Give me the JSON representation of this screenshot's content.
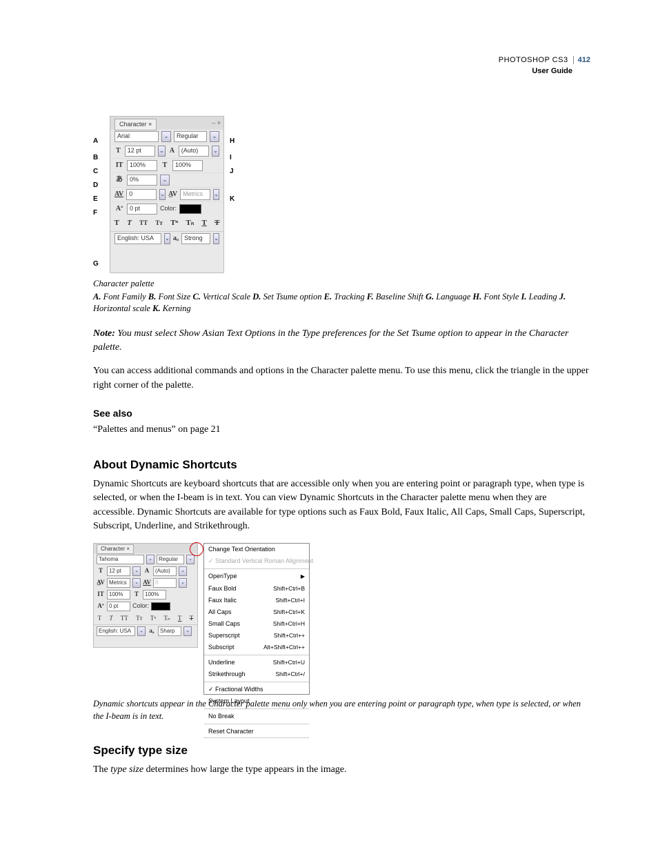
{
  "header": {
    "product": "PHOTOSHOP CS3",
    "pageno": "412",
    "subtitle": "User Guide"
  },
  "fig1": {
    "tab": "Character ×",
    "close": "– ×",
    "font_family": "Arial",
    "font_style": "Regular",
    "font_size": "12 pt",
    "leading": "(Auto)",
    "vscale": "100%",
    "hscale": "100%",
    "tsume": "0%",
    "tracking": "0",
    "kerning": "Metrics",
    "baseline": "0 pt",
    "color_label": "Color:",
    "language": "English: USA",
    "aa_label": "aₐ",
    "aa_value": "Strong",
    "callouts": {
      "A": "A",
      "B": "B",
      "C": "C",
      "D": "D",
      "E": "E",
      "F": "F",
      "G": "G",
      "H": "H",
      "I": "I",
      "J": "J",
      "K": "K"
    }
  },
  "fig1_caption": "Character palette",
  "fig1_legend_parts": [
    {
      "b": "A.",
      "t": " Font Family  "
    },
    {
      "b": "B.",
      "t": " Font Size  "
    },
    {
      "b": "C.",
      "t": " Vertical Scale  "
    },
    {
      "b": "D.",
      "t": " Set Tsume option  "
    },
    {
      "b": "E.",
      "t": " Tracking  "
    },
    {
      "b": "F.",
      "t": " Baseline Shift  "
    },
    {
      "b": "G.",
      "t": " Language  "
    },
    {
      "b": "H.",
      "t": " Font Style  "
    },
    {
      "b": "I.",
      "t": " Leading "
    },
    {
      "b": "J.",
      "t": " Horizontal scale  "
    },
    {
      "b": "K.",
      "t": " Kerning"
    }
  ],
  "note_label": "Note:",
  "note_text": " You must select Show Asian Text Options in the Type preferences for the Set Tsume option to appear in the Character palette.",
  "para_access": "You can access additional commands and options in the Character palette menu. To use this menu, click the triangle in the upper right corner of the palette.",
  "see_also_heading": "See also",
  "see_also_link": "“Palettes and menus” on page 21",
  "section_dynamic": "About Dynamic Shortcuts",
  "para_dynamic": "Dynamic Shortcuts are keyboard shortcuts that are accessible only when you are entering point or paragraph type, when type is selected, or when the I-beam is in text. You can view Dynamic Shortcuts in the Character palette menu when they are accessible. Dynamic Shortcuts are available for type options such as Faux Bold, Faux Italic, All Caps, Small Caps, Superscript, Subscript, Underline, and Strikethrough.",
  "fig2": {
    "tab": "Character ×",
    "font_family": "Tahoma",
    "font_style": "Regular",
    "font_size": "12 pt",
    "leading": "(Auto)",
    "kerning": "Metrics",
    "tracking": "0",
    "vscale": "100%",
    "hscale": "100%",
    "baseline": "0 pt",
    "color_label": "Color:",
    "language": "English: USA",
    "aa_value": "Sharp",
    "menu": {
      "change_orient": "Change Text Orientation",
      "svra": "Standard Vertical Roman Alignment",
      "opentype": "OpenType",
      "items": [
        {
          "label": "Faux Bold",
          "sc": "Shift+Ctrl+B"
        },
        {
          "label": "Faux Italic",
          "sc": "Shift+Ctrl+I"
        },
        {
          "label": "All Caps",
          "sc": "Shift+Ctrl+K"
        },
        {
          "label": "Small Caps",
          "sc": "Shift+Ctrl+H"
        },
        {
          "label": "Superscript",
          "sc": "Shift+Ctrl++"
        },
        {
          "label": "Subscript",
          "sc": "Alt+Shift+Ctrl++"
        }
      ],
      "items2": [
        {
          "label": "Underline",
          "sc": "Shift+Ctrl+U"
        },
        {
          "label": "Strikethrough",
          "sc": "Shift+Ctrl+/"
        }
      ],
      "fractional": "Fractional Widths",
      "system_layout": "System Layout",
      "no_break": "No Break",
      "reset": "Reset Character"
    }
  },
  "fig2_caption": "Dynamic shortcuts appear in the Character palette menu only when you are entering point or paragraph type, when type is selected, or when the I-beam is in text.",
  "section_typesize": "Specify type size",
  "para_typesize_pre": "The ",
  "para_typesize_em": "type size",
  "para_typesize_post": " determines how large the type appears in the image."
}
